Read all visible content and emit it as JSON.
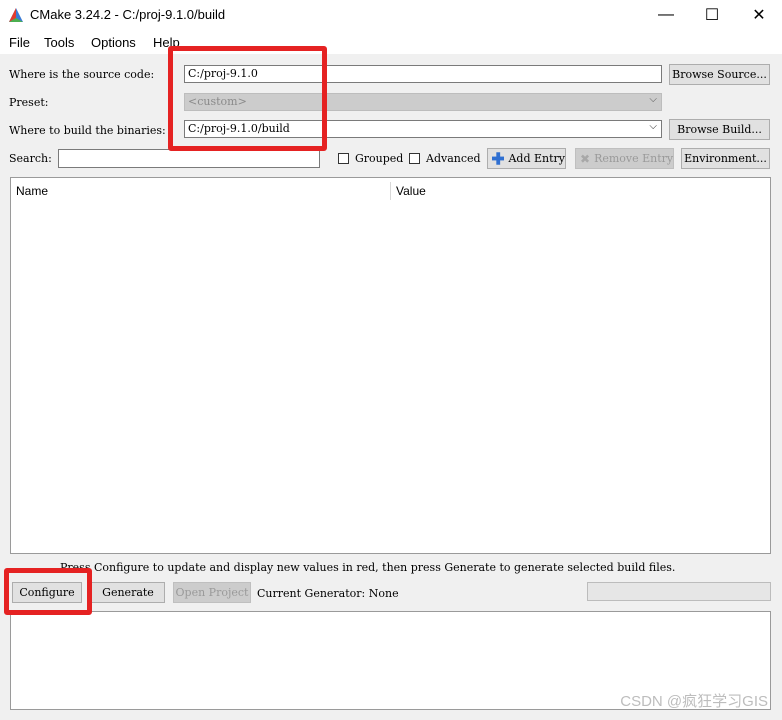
{
  "window": {
    "title": "CMake 3.24.2 - C:/proj-9.1.0/build",
    "minimize_glyph": "—",
    "maximize_glyph": "☐",
    "close_glyph": "✕"
  },
  "menu": [
    "File",
    "Tools",
    "Options",
    "Help"
  ],
  "source": {
    "label": "Where is the source code:",
    "value": "C:/proj-9.1.0",
    "browse_label": "Browse Source..."
  },
  "preset": {
    "label": "Preset:",
    "value": "<custom>"
  },
  "build": {
    "label": "Where to build the binaries:",
    "value": "C:/proj-9.1.0/build",
    "browse_label": "Browse Build..."
  },
  "search": {
    "label": "Search:",
    "value": ""
  },
  "options": {
    "grouped_label": "Grouped",
    "grouped_checked": false,
    "advanced_label": "Advanced",
    "advanced_checked": false
  },
  "toolbar": {
    "add_entry_label": "Add Entry",
    "remove_entry_label": "Remove Entry",
    "environment_label": "Environment..."
  },
  "table": {
    "columns": [
      "Name",
      "Value"
    ]
  },
  "hint": "Press Configure to update and display new values in red, then press Generate to generate selected build files.",
  "actions": {
    "configure_label": "Configure",
    "generate_label": "Generate",
    "open_project_label": "Open Project"
  },
  "generator": {
    "text": "Current Generator: None"
  },
  "watermark": "CSDN @疯狂学习GIS",
  "colors": {
    "highlight": "#e52222",
    "add_icon": "#2f6fd1"
  }
}
